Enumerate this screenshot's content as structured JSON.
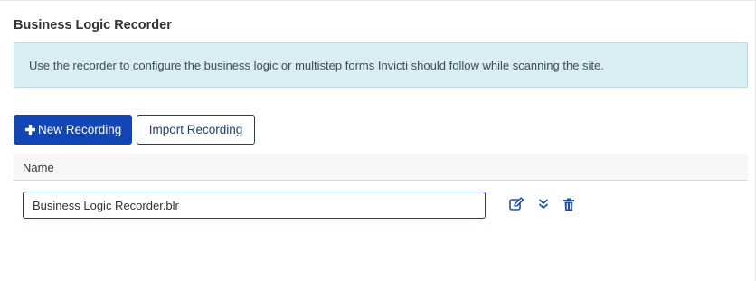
{
  "section": {
    "title": "Business Logic Recorder",
    "info_text": "Use the recorder to configure the business logic or multistep forms Invicti should follow while scanning the site."
  },
  "toolbar": {
    "new_recording_label": "New Recording",
    "import_recording_label": "Import Recording"
  },
  "table": {
    "columns": [
      "Name"
    ],
    "rows": [
      {
        "name_value": "Business Logic Recorder.blr",
        "actions": [
          "edit-icon",
          "expand-icon",
          "trash-icon"
        ]
      }
    ]
  },
  "colors": {
    "primary": "#1246b4",
    "info_background": "#d9eef0",
    "icon": "#1f4fae"
  }
}
